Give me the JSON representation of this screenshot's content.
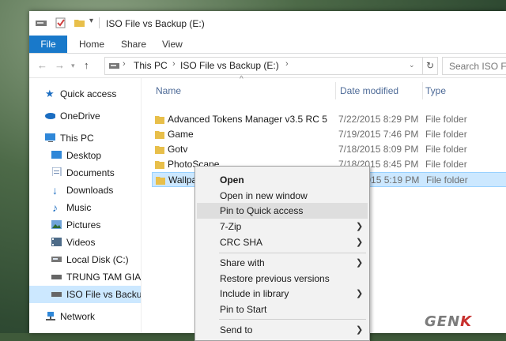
{
  "window": {
    "title": "ISO File vs Backup (E:)"
  },
  "ribbon": {
    "tabs": [
      "File",
      "Home",
      "Share",
      "View"
    ]
  },
  "address": {
    "path": [
      "This PC",
      "ISO File vs Backup (E:)"
    ],
    "search_placeholder": "Search ISO File vs Backup (E:)"
  },
  "nav": {
    "quick_access": "Quick access",
    "onedrive": "OneDrive",
    "this_pc": "This PC",
    "items": [
      "Desktop",
      "Documents",
      "Downloads",
      "Music",
      "Pictures",
      "Videos",
      "Local Disk (C:)",
      "TRUNG TAM GIAI T",
      "ISO File vs Backup ("
    ],
    "network": "Network"
  },
  "columns": {
    "name": "Name",
    "date": "Date modified",
    "type": "Type"
  },
  "files": [
    {
      "name": "Advanced Tokens Manager v3.5 RC 5",
      "date": "7/22/2015 8:29 PM",
      "type": "File folder"
    },
    {
      "name": "Game",
      "date": "7/19/2015 7:46 PM",
      "type": "File folder"
    },
    {
      "name": "Gotv",
      "date": "7/18/2015 8:09 PM",
      "type": "File folder"
    },
    {
      "name": "PhotoScape",
      "date": "7/18/2015 8:45 PM",
      "type": "File folder"
    },
    {
      "name": "Wallpa",
      "date": "7/22/2015 5:19 PM",
      "type": "File folder"
    }
  ],
  "context_menu": {
    "open": "Open",
    "open_new_window": "Open in new window",
    "pin_quick_access": "Pin to Quick access",
    "seven_zip": "7-Zip",
    "crc_sha": "CRC SHA",
    "share_with": "Share with",
    "restore_previous": "Restore previous versions",
    "include_library": "Include in library",
    "pin_start": "Pin to Start",
    "send_to": "Send to"
  },
  "watermark": {
    "prefix": "GEN",
    "suffix": "K"
  },
  "colors": {
    "file_tab": "#1979ca",
    "selection": "#cce8ff",
    "folder": "#e8bf4a",
    "header_text": "#4d6a97"
  }
}
